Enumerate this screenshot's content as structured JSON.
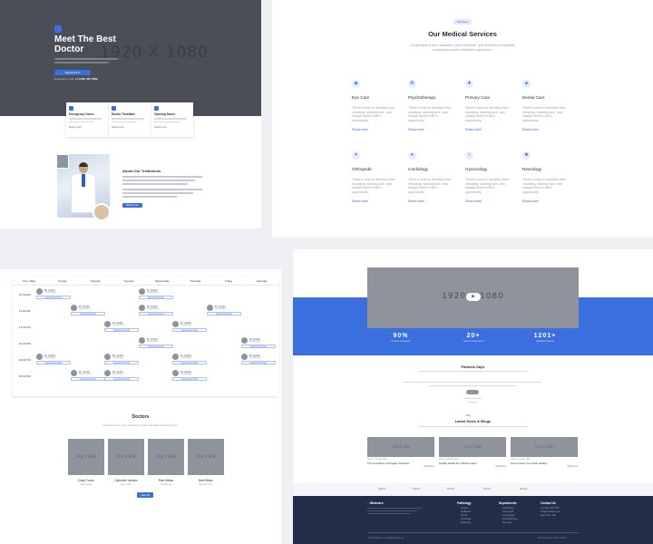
{
  "hero": {
    "title": "Meet The Best Doctor",
    "placeholder": "1920 X 1080",
    "button": "Appointment",
    "note_prefix": "Emergency Call:",
    "note_value": "+1 (123) 456 7890"
  },
  "info_cards": [
    {
      "title": "Emergency Cases",
      "link": "Read more"
    },
    {
      "title": "Doctor Timetable",
      "link": "Read more"
    },
    {
      "title": "Opening Hours",
      "link": "Read more"
    }
  ],
  "about": {
    "title": "About Our Treatments",
    "button": "Read more"
  },
  "services": {
    "tag": "Services",
    "title": "Our Medical Services",
    "subtitle": "Doloremque ut quo voluptatem quasi voluptate, quis architecto perspiciatis consequatur ipsam voluptatem asperiores.",
    "desc": "There's more to dentistry than checking, making sure, and straight teeth in life's opportunity.",
    "link": "Read more",
    "items": [
      {
        "name": "Eye Care",
        "icon": "eye-icon",
        "glyph": "◉"
      },
      {
        "name": "Psychotherapy",
        "icon": "brain-icon",
        "glyph": "❂"
      },
      {
        "name": "Primary Care",
        "icon": "stethoscope-icon",
        "glyph": "✚"
      },
      {
        "name": "Dental Care",
        "icon": "tooth-icon",
        "glyph": "◈"
      },
      {
        "name": "Orthopedic",
        "icon": "bone-icon",
        "glyph": "✦"
      },
      {
        "name": "Cardiology",
        "icon": "heartbeat-icon",
        "glyph": "♥"
      },
      {
        "name": "Gynecology",
        "icon": "female-icon",
        "glyph": "♀"
      },
      {
        "name": "Neurology",
        "icon": "nerve-icon",
        "glyph": "✺"
      }
    ]
  },
  "schedule": {
    "days": [
      "Time Table",
      "Sunday",
      "Monday",
      "Tuesday",
      "Wednesday",
      "Thursday",
      "Friday",
      "Saturday"
    ],
    "times": [
      "10:00 AM",
      "11:00 AM",
      "12:00 PM",
      "01:00 PM",
      "02:00 PM",
      "03:00 PM"
    ],
    "appt_name": "Dr. Smith",
    "appt_role": "Cardiologist",
    "appt_button": "Appointment Now"
  },
  "doctors": {
    "title": "Doctors",
    "subtitle": "Doloremque ut quo voluptatem quasi voluptate quis architecto.",
    "placeholder": "600 X 800",
    "button": "View All",
    "items": [
      {
        "name": "Cindy Turner",
        "role": "Neurology"
      },
      {
        "name": "Catherine Jenkins",
        "role": "Eye Care"
      },
      {
        "name": "Ravi Mehta",
        "role": "Cardiology"
      },
      {
        "name": "Brett Bhole",
        "role": "Dental Care"
      }
    ]
  },
  "video": {
    "placeholder": "1920 X 1080",
    "play": "▶"
  },
  "stats": [
    {
      "value": "90%",
      "label": "Positive Feedback"
    },
    {
      "value": "20+",
      "label": "Years of Experience"
    },
    {
      "value": "1201+",
      "label": "Satisfied Patients"
    }
  ],
  "testimonials": {
    "title": "Patients Says"
  },
  "blog": {
    "tag": "Blog",
    "title": "Latest News & Blogs",
    "placeholder": "1920 X 1080",
    "cards": [
      {
        "meta": "Admin | 12 May 2024",
        "title": "The Importance of Regular Checkups",
        "link": "Read more"
      },
      {
        "meta": "Admin | 18 May 2024",
        "title": "Healthy Habits For a Better Heart",
        "link": "Read more"
      },
      {
        "meta": "Admin | 24 May 2024",
        "title": "How to Keep Your Teeth Healthy",
        "link": "Read more"
      }
    ]
  },
  "partners": [
    "Partner",
    "Partner",
    "Partner",
    "Partner",
    "Partner"
  ],
  "footer": {
    "logo_mark": "●",
    "logo": "Medcare",
    "col1_title": "Pathology",
    "col1_items": [
      "Surgery",
      "Pediatrics",
      "Dental",
      "Neurology",
      "Radiology"
    ],
    "col2_title": "Departments",
    "col2_items": [
      "Cardiology",
      "Orthopedic",
      "Gynecology",
      "Psychotherapy",
      "Eye Care"
    ],
    "col3_title": "Contact Us",
    "col3_items": [
      "+1 (123) 456 7890",
      "info@medcare.com",
      "New York, USA"
    ],
    "copyright": "© 2024 Medcare. All Rights Reserved.",
    "links": "Privacy Policy | Terms of Use"
  }
}
